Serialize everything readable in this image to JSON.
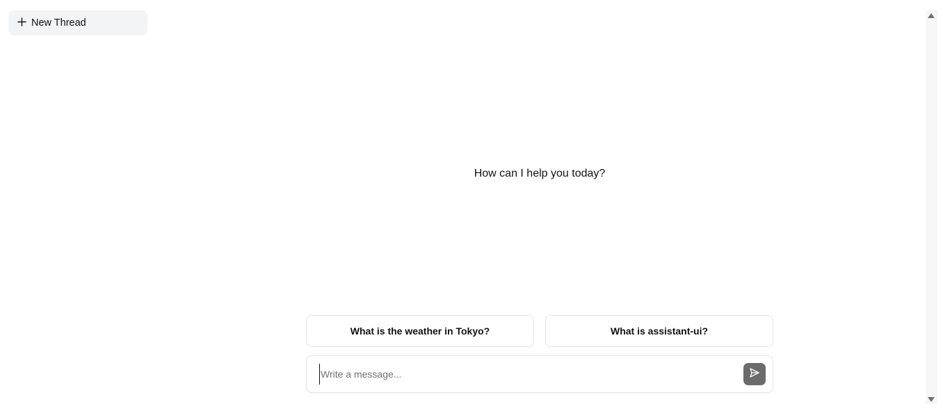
{
  "sidebar": {
    "new_thread_label": "New Thread",
    "new_thread_icon": "plus-icon"
  },
  "thread": {
    "welcome": "How can I help you today?",
    "suggestions": [
      {
        "label": "What is the weather in Tokyo?"
      },
      {
        "label": "What is assistant-ui?"
      }
    ]
  },
  "composer": {
    "placeholder": "Write a message...",
    "value": "",
    "send_icon": "send-icon",
    "send_button_color": "#6b6b6b"
  },
  "scrollbar": {
    "up_icon": "scroll-up-arrow-icon",
    "down_icon": "scroll-down-arrow-icon"
  }
}
